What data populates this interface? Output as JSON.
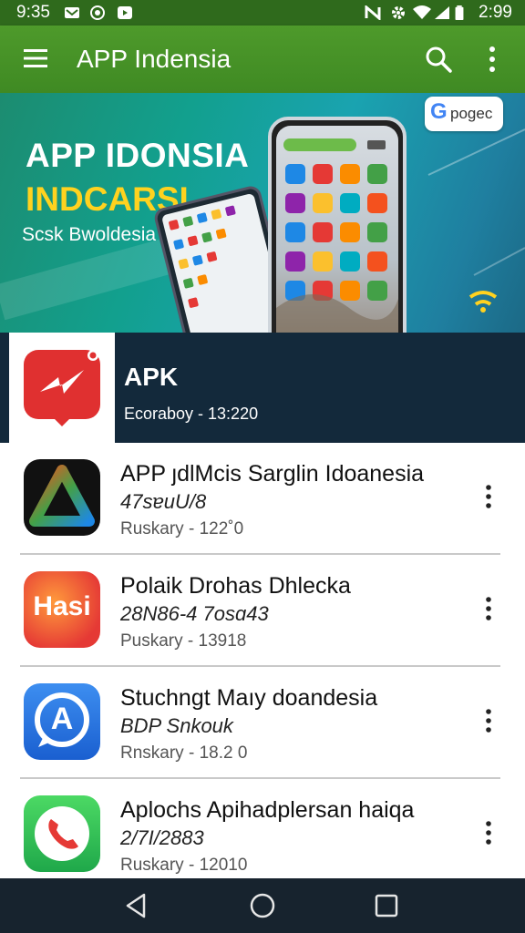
{
  "status_bar": {
    "time": "9:35",
    "clock": "2:99",
    "left_icons": [
      "mail-icon",
      "camera-icon",
      "video-icon"
    ],
    "right_icons": [
      "nfc-icon",
      "settings-icon",
      "wifi-icon",
      "signal-icon",
      "battery-icon"
    ]
  },
  "app_bar": {
    "title": "APP Indensia",
    "color": "#4e9a2b"
  },
  "banner": {
    "heading": "APP IDONSIA",
    "subheading": "INDCARSI",
    "tagline": "Scsk Bwoldesia",
    "badge_text": "pogec",
    "badge_letter": "G",
    "accent_color": "#ffd21f"
  },
  "featured": {
    "title": "APK",
    "meta": "Ecoraboy - 13:220",
    "icon": "lightning-icon"
  },
  "apps": [
    {
      "title": "APP ȷdlMcis Sarglin Idoanesia",
      "subtitle": "47sɐuU/8",
      "meta": "Ruskary - 122˚0",
      "icon": "triangle-app-icon"
    },
    {
      "title": "Polaik Drohas Dhlecka",
      "subtitle": "28N86-4 7osɑ43",
      "meta": "Puskary - 13918",
      "icon": "hasi-app-icon",
      "icon_text": "Hasi"
    },
    {
      "title": "Stuchngt Maıy doandesia",
      "subtitle": "BDP Snkouk",
      "meta": "Rnskary - 18.2 0",
      "icon": "letter-a-app-icon",
      "icon_text": "A"
    },
    {
      "title": "Aplochs Apihadplersan haiqa",
      "subtitle": "2/7I/2883",
      "meta": "Ruskary - 12010",
      "icon": "phone-app-icon"
    }
  ],
  "nav_bar": {
    "buttons": [
      "back-icon",
      "home-icon",
      "recents-icon"
    ]
  }
}
